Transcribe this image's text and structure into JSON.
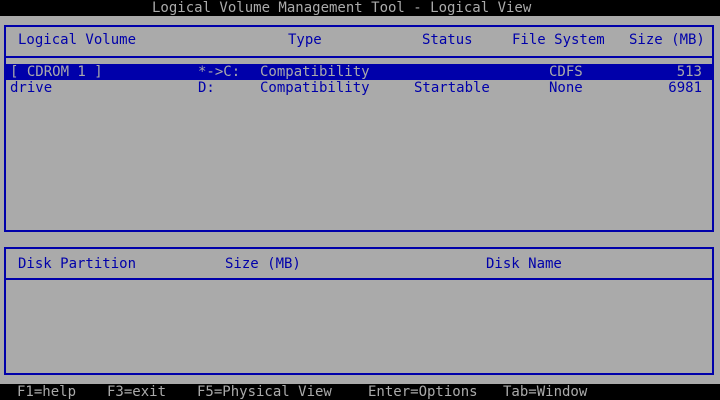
{
  "title": "Logical Volume Management Tool - Logical View",
  "top_panel": {
    "columns": {
      "logical_volume": "Logical Volume",
      "type": "Type",
      "status": "Status",
      "file_system": "File System",
      "size": "Size (MB)"
    },
    "rows": [
      {
        "volume": "[ CDROM 1 ]",
        "drive": "*->C:",
        "type": "Compatibility",
        "status": "",
        "file_system": "CDFS",
        "size": "513",
        "selected": true
      },
      {
        "volume": "drive",
        "drive": "D:",
        "type": "Compatibility",
        "status": "Startable",
        "file_system": "None",
        "size": "6981",
        "selected": false
      }
    ]
  },
  "bottom_panel": {
    "columns": {
      "disk_partition": "Disk Partition",
      "size": "Size (MB)",
      "disk_name": "Disk Name"
    }
  },
  "statusbar": {
    "help": "F1=help",
    "exit": "F3=exit",
    "physical_view": "F5=Physical View",
    "options": "Enter=Options",
    "window": "Tab=Window"
  },
  "colors": {
    "background": "#aaaaaa",
    "text": "#0000aa",
    "bar": "#000000",
    "selection": "#0000aa"
  }
}
